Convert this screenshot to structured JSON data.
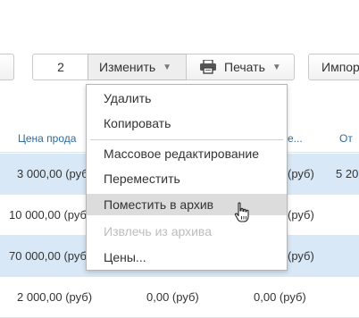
{
  "toolbar": {
    "counter_value": "2",
    "change_label": "Изменить",
    "print_label": "Печать",
    "import_label": "Импор"
  },
  "table": {
    "headers": [
      "Цена прода",
      "е...",
      "От"
    ],
    "rows": [
      {
        "price": "3 000,00 (руб)",
        "col2": "",
        "col3": "(руб)",
        "col4": "5 20",
        "selected": true
      },
      {
        "price": "10 000,00 (руб)",
        "col2": "",
        "col3": "(руб)",
        "col4": "",
        "selected": false
      },
      {
        "price": "70 000,00 (руб)",
        "col2": "",
        "col3": "(руб)",
        "col4": "",
        "selected": true
      },
      {
        "price": "2 000,00 (руб)",
        "col2": "0,00 (руб)",
        "col3": "0,00 (руб)",
        "col4": "",
        "selected": false
      }
    ]
  },
  "menu": {
    "items": [
      {
        "label": "Удалить",
        "state": "normal"
      },
      {
        "label": "Копировать",
        "state": "normal"
      },
      {
        "label": "Массовое редактирование",
        "state": "normal"
      },
      {
        "label": "Переместить",
        "state": "normal"
      },
      {
        "label": "Поместить в архив",
        "state": "hover"
      },
      {
        "label": "Извлечь из архива",
        "state": "disabled"
      },
      {
        "label": "Цены...",
        "state": "normal"
      }
    ]
  },
  "icons": {
    "print": "printer-icon",
    "caret": "caret-down-icon",
    "cursor": "hand-pointer-icon"
  },
  "colors": {
    "header_link": "#2d6ca2",
    "selected_row": "#d9e8f6",
    "menu_hover": "#dcdcdc",
    "disabled_text": "#bdbdbd"
  }
}
